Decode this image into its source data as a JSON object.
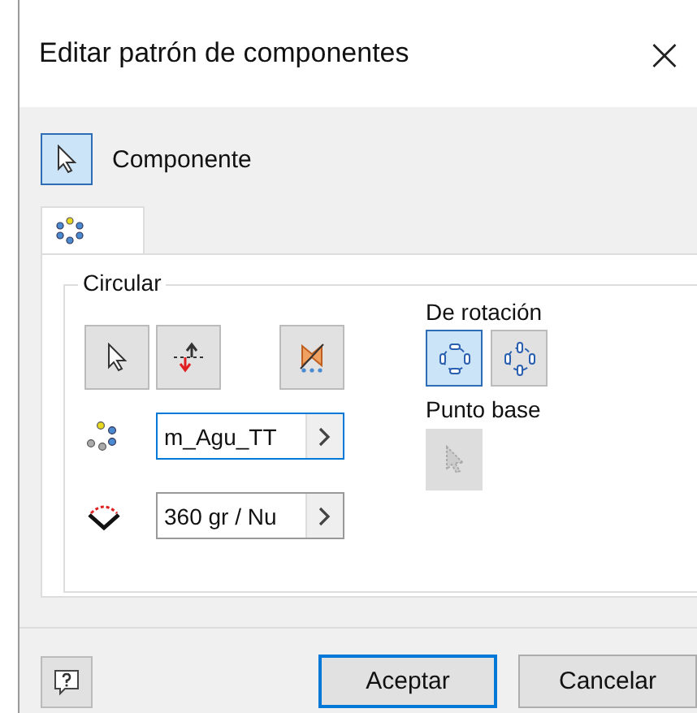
{
  "window": {
    "title": "Editar patrón de componentes",
    "close": "×"
  },
  "component": {
    "label": "Componente",
    "selected": true
  },
  "tabs": [
    {
      "kind": "pattern",
      "selected": true
    }
  ],
  "circular": {
    "title": "Circular",
    "fields": [
      {
        "kind": "count",
        "value": "m_Agu_TT",
        "focused": true
      },
      {
        "kind": "angle",
        "value": "360 gr / Nu",
        "focused": false
      }
    ]
  },
  "rotation": {
    "label": "De rotación",
    "options": [
      {
        "kind": "rotate",
        "selected": true
      },
      {
        "kind": "fixed",
        "selected": false
      }
    ]
  },
  "base_point": {
    "label": "Punto base",
    "disabled": true
  },
  "buttons": [
    {
      "label": "Aceptar",
      "default": true
    },
    {
      "label": "Cancelar",
      "default": false
    }
  ]
}
